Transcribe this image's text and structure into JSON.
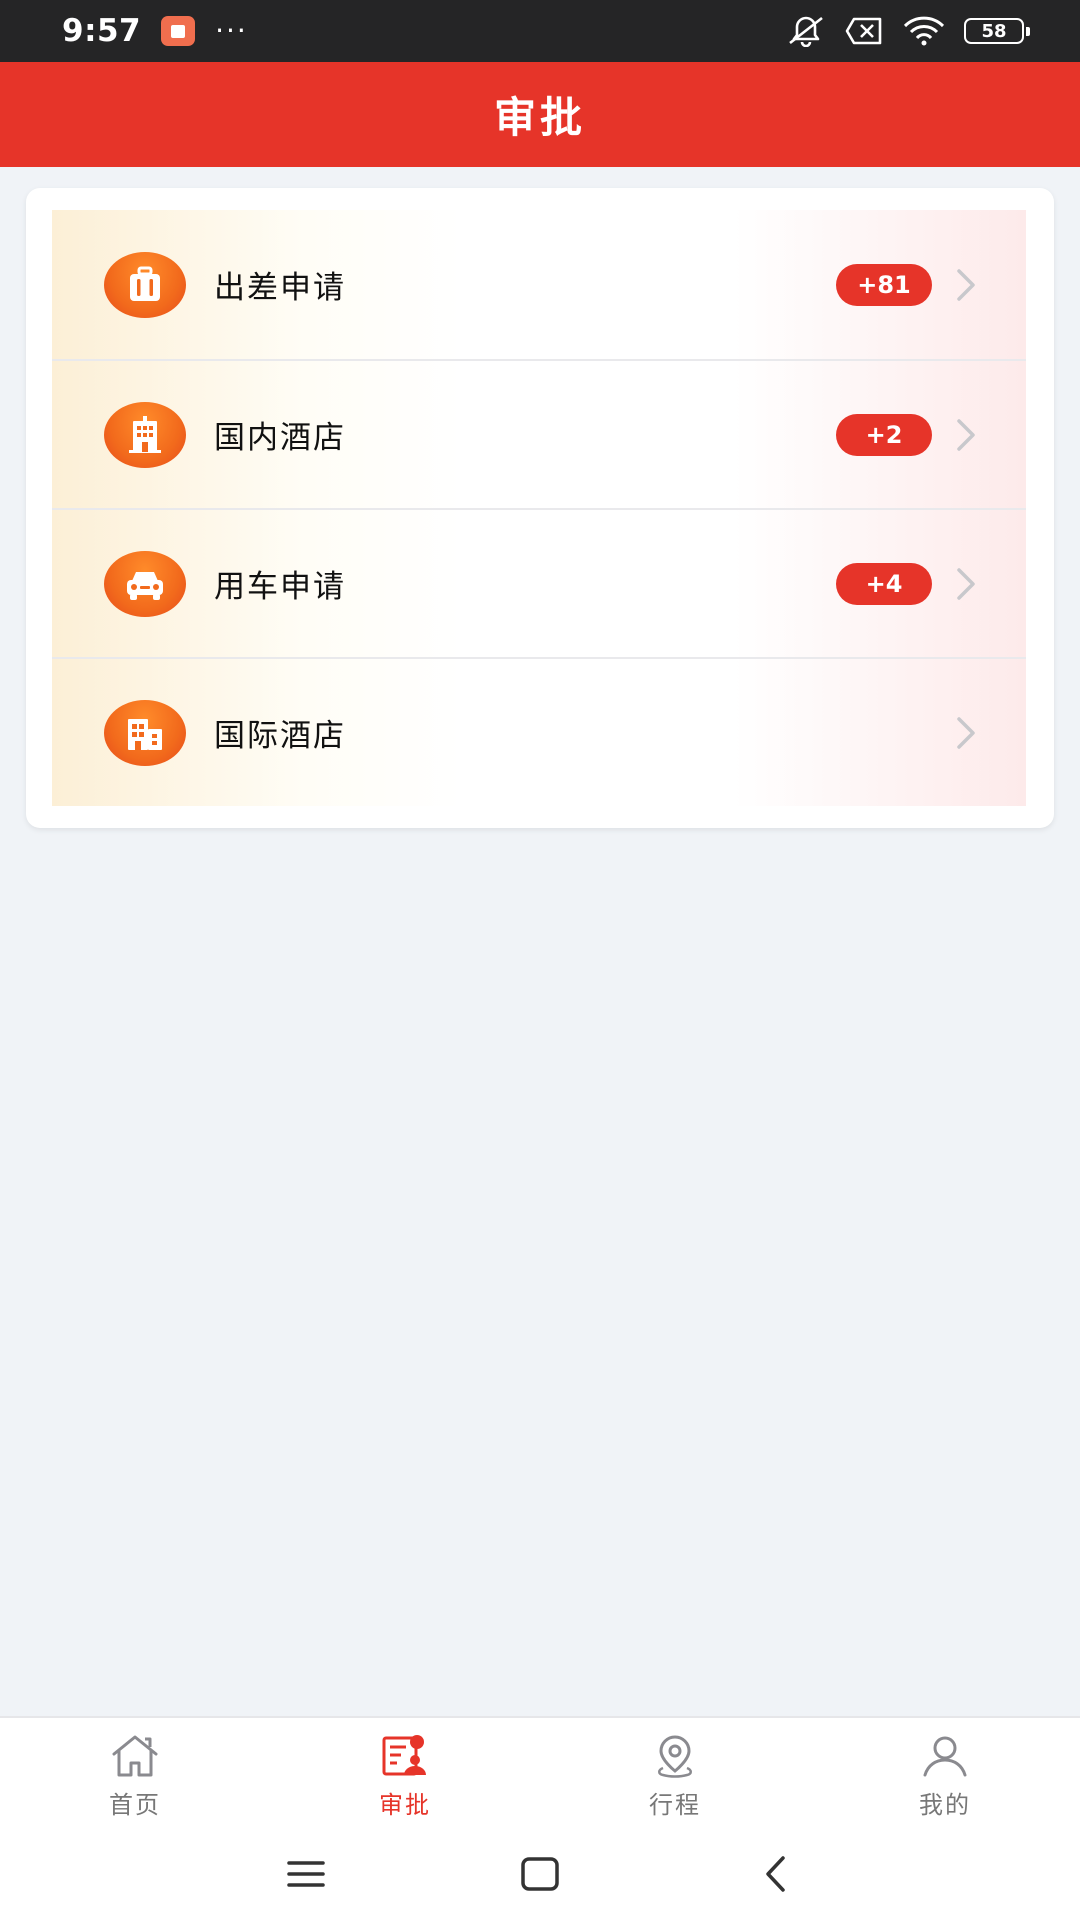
{
  "status_bar": {
    "time": "9:57",
    "overflow": "···",
    "battery": "58"
  },
  "header": {
    "title": "审批"
  },
  "menu": {
    "items": [
      {
        "label": "出差申请",
        "badge": "+81",
        "icon": "luggage-icon"
      },
      {
        "label": "国内酒店",
        "badge": "+2",
        "icon": "hotel-icon"
      },
      {
        "label": "用车申请",
        "badge": "+4",
        "icon": "car-icon"
      },
      {
        "label": "国际酒店",
        "badge": "",
        "icon": "building-icon"
      }
    ]
  },
  "tab_bar": {
    "active": "审批",
    "tabs": [
      {
        "label": "首页",
        "icon": "home-icon"
      },
      {
        "label": "审批",
        "icon": "approval-icon"
      },
      {
        "label": "行程",
        "icon": "location-icon"
      },
      {
        "label": "我的",
        "icon": "user-icon"
      }
    ]
  },
  "colors": {
    "brand": "#e63429",
    "icon_orange": "#f26a1c",
    "background": "#f0f3f7"
  }
}
